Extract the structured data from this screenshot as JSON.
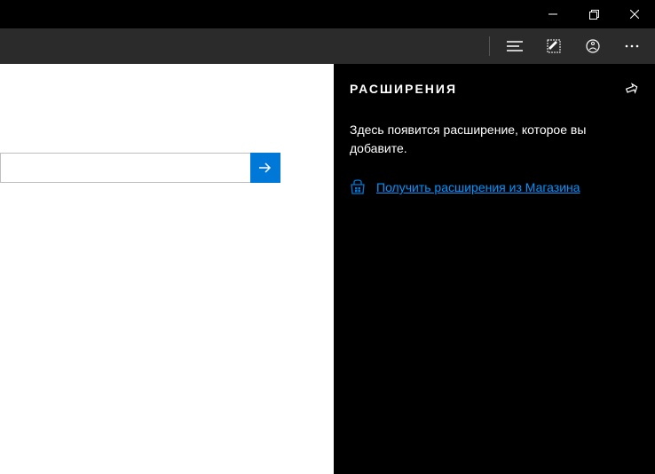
{
  "panel": {
    "title": "РАСШИРЕНИЯ",
    "empty_text": "Здесь появится расширение, которое вы добавите.",
    "store_link": "Получить расширения из Магазина"
  },
  "search": {
    "value": "",
    "placeholder": ""
  }
}
